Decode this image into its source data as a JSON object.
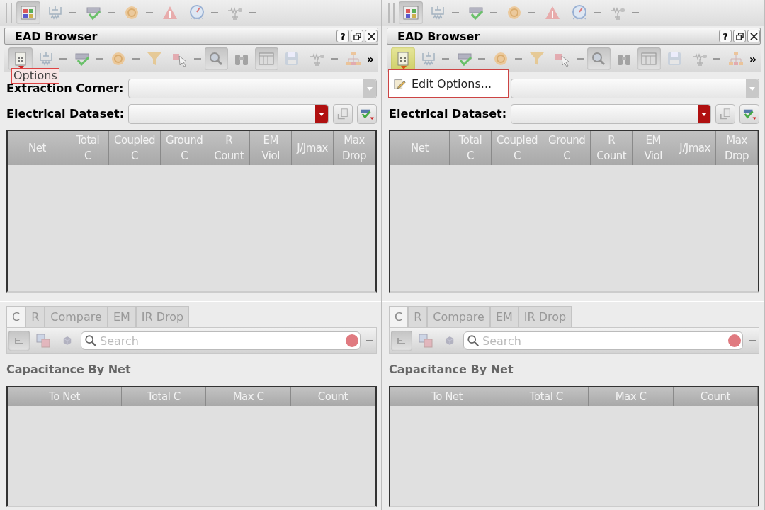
{
  "panes": [
    {
      "app_toolbar": [
        {
          "kind": "grid",
          "pressed": true,
          "separator_after": false
        },
        {
          "kind": "capacitor",
          "pressed": false,
          "separator_after": true
        },
        {
          "kind": "check",
          "pressed": false,
          "separator_after": true
        },
        {
          "kind": "circle",
          "pressed": false,
          "separator_after": true
        },
        {
          "kind": "warning",
          "pressed": false,
          "separator_after": false
        },
        {
          "kind": "gauge",
          "pressed": false,
          "separator_after": true
        },
        {
          "kind": "network",
          "pressed": false,
          "separator_after": true
        }
      ],
      "title": "EAD Browser",
      "help_label": "?",
      "toolbar": [
        {
          "kind": "options",
          "pressed": true,
          "separator_after": false
        },
        {
          "kind": "capacitor",
          "pressed": false,
          "separator_after": true
        },
        {
          "kind": "check",
          "pressed": false,
          "separator_after": true
        },
        {
          "kind": "circle",
          "pressed": false,
          "separator_after": true
        },
        {
          "kind": "funnel",
          "pressed": false,
          "separator_after": false
        },
        {
          "kind": "pointer",
          "pressed": false,
          "separator_after": true
        },
        {
          "kind": "zoom",
          "pressed": true,
          "separator_after": false
        },
        {
          "kind": "binoculars",
          "pressed": false,
          "separator_after": false
        },
        {
          "kind": "table",
          "pressed": true,
          "separator_after": false
        },
        {
          "kind": "save",
          "pressed": false,
          "separator_after": false
        },
        {
          "kind": "network",
          "pressed": false,
          "separator_after": true
        },
        {
          "kind": "hierarchy",
          "pressed": false,
          "separator_after": false
        }
      ],
      "overflow": "»",
      "popup": {
        "kind": "tooltip",
        "text": "Options"
      },
      "corner_label": "Extraction Corner:",
      "dataset_label": "Electrical Dataset:",
      "columns": [
        "Net",
        "Total C",
        "Coupled C",
        "Ground C",
        "R Count",
        "EM Viol",
        "J/Jmax",
        "Max Drop"
      ],
      "tabs": [
        {
          "label": "C",
          "selected": true
        },
        {
          "label": "R",
          "selected": false
        },
        {
          "label": "Compare",
          "selected": false
        },
        {
          "label": "EM",
          "selected": false
        },
        {
          "label": "IR Drop",
          "selected": false
        }
      ],
      "search": {
        "placeholder": "Search"
      },
      "caption": "Capacitance By Net",
      "sub_columns": [
        "To Net",
        "Total C",
        "Max C",
        "Count"
      ]
    },
    {
      "app_toolbar": [
        {
          "kind": "grid",
          "pressed": true,
          "separator_after": false
        },
        {
          "kind": "capacitor",
          "pressed": false,
          "separator_after": true
        },
        {
          "kind": "check",
          "pressed": false,
          "separator_after": true
        },
        {
          "kind": "circle",
          "pressed": false,
          "separator_after": true
        },
        {
          "kind": "warning",
          "pressed": false,
          "separator_after": false
        },
        {
          "kind": "gauge",
          "pressed": false,
          "separator_after": true
        },
        {
          "kind": "network",
          "pressed": false,
          "separator_after": true
        }
      ],
      "title": "EAD Browser",
      "help_label": "?",
      "toolbar": [
        {
          "kind": "options",
          "pressed": true,
          "separator_after": false
        },
        {
          "kind": "capacitor",
          "pressed": false,
          "separator_after": true
        },
        {
          "kind": "check",
          "pressed": false,
          "separator_after": true
        },
        {
          "kind": "circle",
          "pressed": false,
          "separator_after": true
        },
        {
          "kind": "funnel",
          "pressed": false,
          "separator_after": false
        },
        {
          "kind": "pointer",
          "pressed": false,
          "separator_after": true
        },
        {
          "kind": "zoom",
          "pressed": true,
          "separator_after": false
        },
        {
          "kind": "binoculars",
          "pressed": false,
          "separator_after": false
        },
        {
          "kind": "table",
          "pressed": true,
          "separator_after": false
        },
        {
          "kind": "save",
          "pressed": false,
          "separator_after": false
        },
        {
          "kind": "network",
          "pressed": false,
          "separator_after": true
        },
        {
          "kind": "hierarchy",
          "pressed": false,
          "separator_after": false
        }
      ],
      "overflow": "»",
      "popup": {
        "kind": "menu",
        "text": "Edit Options..."
      },
      "dataset_label": "Electrical Dataset:",
      "columns": [
        "Net",
        "Total C",
        "Coupled C",
        "Ground C",
        "R Count",
        "EM Viol",
        "J/Jmax",
        "Max Drop"
      ],
      "tabs": [
        {
          "label": "C",
          "selected": true
        },
        {
          "label": "R",
          "selected": false
        },
        {
          "label": "Compare",
          "selected": false
        },
        {
          "label": "EM",
          "selected": false
        },
        {
          "label": "IR Drop",
          "selected": false
        }
      ],
      "search": {
        "placeholder": "Search"
      },
      "caption": "Capacitance By Net",
      "sub_columns": [
        "To Net",
        "Total C",
        "Max C",
        "Count"
      ]
    }
  ]
}
